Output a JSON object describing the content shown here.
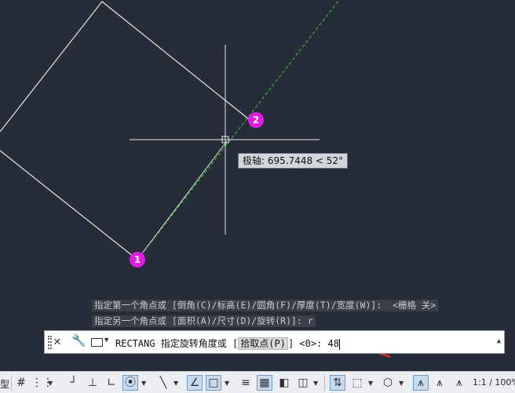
{
  "canvas": {
    "background": "#262c38",
    "tracking_line_color": "#3fbf3f",
    "geometry_color": "#ffffff"
  },
  "tooltip": {
    "text": "极轴: 695.7448 < 52°"
  },
  "markers": [
    {
      "label": "1",
      "color": "#e21be2"
    },
    {
      "label": "2",
      "color": "#e21be2"
    }
  ],
  "command_history": [
    "指定第一个角点或 [倒角(C)/标高(E)/圆角(F)/厚度(T)/宽度(W)]:  <栅格 关>",
    "指定另一个角点或 [面积(A)/尺寸(D)/旋转(R)]: r"
  ],
  "command_line": {
    "close_icon": "close-icon",
    "customize_icon": "wrench-icon",
    "command_icon": "rectangle-icon",
    "prompt_prefix": "RECTANG 指定旋转角度或 [",
    "option": "拾取点(P)",
    "prompt_suffix": "] <0>: ",
    "input_value": "48"
  },
  "status_bar": {
    "left_label": "型",
    "scale_label": "1:1 / 100%",
    "icons": [
      "grid-icon",
      "snap-icon",
      "infer-constraints-icon",
      "ortho-icon",
      "polar-icon",
      "isodraft-icon",
      "osnap-tracking-icon",
      "osnap-icon",
      "lineweight-icon",
      "transparency-icon",
      "selection-cycling-icon",
      "3d-osnap-icon",
      "dynamic-ucs-icon",
      "selection-filter-icon",
      "gizmo-icon",
      "annotation-visibility-icon",
      "auto-scale-icon",
      "annotation-scale-icon"
    ]
  },
  "annotation": {
    "arrow_color": "#e0332b"
  }
}
